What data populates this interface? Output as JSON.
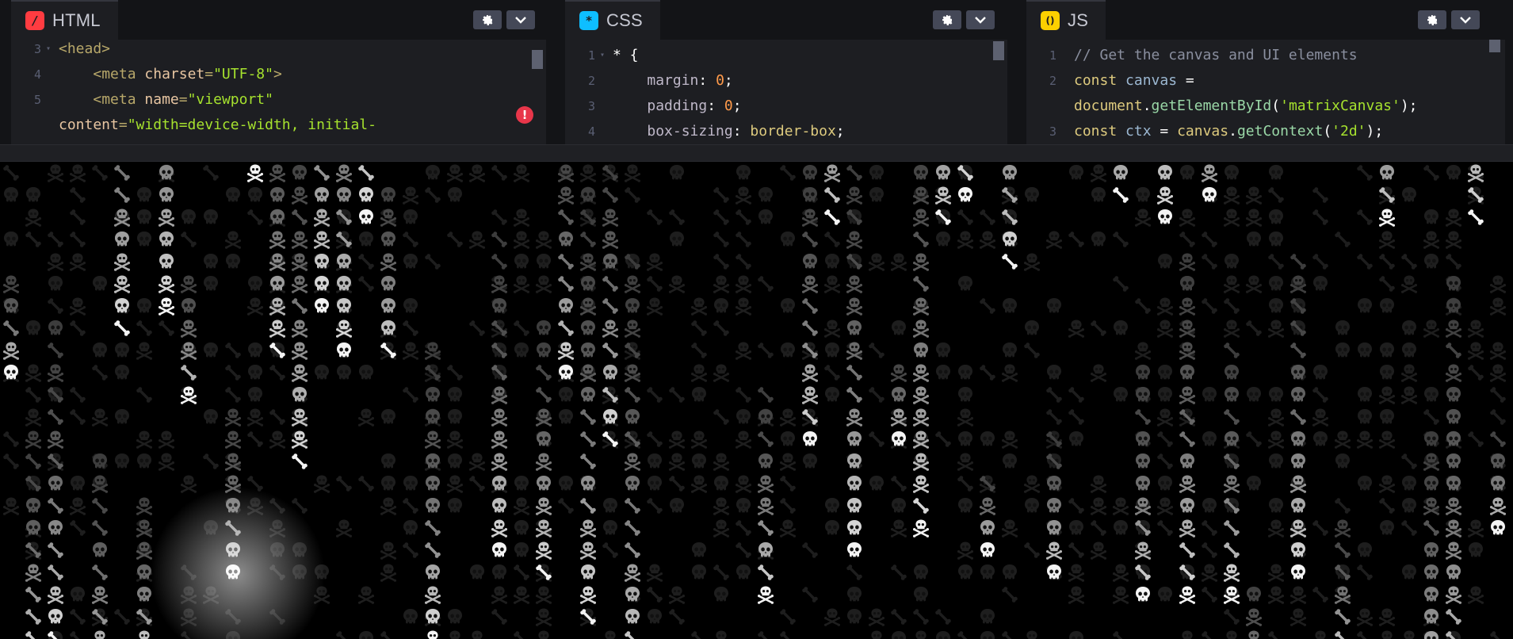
{
  "editors": {
    "html": {
      "label": "HTML",
      "icon_glyph": "/",
      "icon_color": "#ff3c41",
      "lines": [
        {
          "n": "3",
          "fold": true,
          "parts": [
            [
              "tag",
              "<head>"
            ]
          ],
          "indent": ""
        },
        {
          "n": "4",
          "fold": false,
          "indent": "    ",
          "parts": [
            [
              "tag",
              "<meta "
            ],
            [
              "attr",
              "charset"
            ],
            [
              "tag",
              "="
            ],
            [
              "str",
              "\"UTF-8\""
            ],
            [
              "tag",
              ">"
            ]
          ]
        },
        {
          "n": "5",
          "fold": false,
          "indent": "    ",
          "parts": [
            [
              "tag",
              "<meta "
            ],
            [
              "attr",
              "name"
            ],
            [
              "tag",
              "="
            ],
            [
              "str",
              "\"viewport\""
            ]
          ]
        },
        {
          "n": "",
          "fold": false,
          "indent": "",
          "parts": [
            [
              "attr",
              "content"
            ],
            [
              "tag",
              "="
            ],
            [
              "str",
              "\"width=device-width, initial-"
            ]
          ]
        }
      ]
    },
    "css": {
      "label": "CSS",
      "icon_glyph": "*",
      "icon_color": "#0ebeff",
      "lines": [
        {
          "n": "1",
          "fold": true,
          "indent": "",
          "parts": [
            [
              "sel",
              "* {"
            ]
          ]
        },
        {
          "n": "2",
          "fold": false,
          "indent": "    ",
          "parts": [
            [
              "prop",
              "margin"
            ],
            [
              "sel",
              ": "
            ],
            [
              "num",
              "0"
            ],
            [
              "sel",
              ";"
            ]
          ]
        },
        {
          "n": "3",
          "fold": false,
          "indent": "    ",
          "parts": [
            [
              "prop",
              "padding"
            ],
            [
              "sel",
              ": "
            ],
            [
              "num",
              "0"
            ],
            [
              "sel",
              ";"
            ]
          ]
        },
        {
          "n": "4",
          "fold": false,
          "indent": "    ",
          "parts": [
            [
              "prop",
              "box-sizing"
            ],
            [
              "sel",
              ": "
            ],
            [
              "kw",
              "border-box"
            ],
            [
              "sel",
              ";"
            ]
          ]
        }
      ]
    },
    "js": {
      "label": "JS",
      "icon_glyph": "()",
      "icon_color": "#fcd000",
      "lines": [
        {
          "n": "1",
          "fold": false,
          "indent": "",
          "parts": [
            [
              "cmt",
              "// Get the canvas and UI elements"
            ]
          ]
        },
        {
          "n": "2",
          "fold": false,
          "indent": "",
          "parts": [
            [
              "kw",
              "const "
            ],
            [
              "var",
              "canvas"
            ],
            [
              "sel",
              " ="
            ]
          ]
        },
        {
          "n": "",
          "fold": false,
          "indent": "",
          "parts": [
            [
              "kw",
              "document"
            ],
            [
              "sel",
              "."
            ],
            [
              "fn",
              "getElementById"
            ],
            [
              "sel",
              "("
            ],
            [
              "str",
              "'matrixCanvas'"
            ],
            [
              "sel",
              ");"
            ]
          ]
        },
        {
          "n": "3",
          "fold": false,
          "indent": "",
          "parts": [
            [
              "kw",
              "const "
            ],
            [
              "var",
              "ctx"
            ],
            [
              "sel",
              " = "
            ],
            [
              "kw",
              "canvas"
            ],
            [
              "sel",
              "."
            ],
            [
              "fn",
              "getContext"
            ],
            [
              "sel",
              "("
            ],
            [
              "str",
              "'2d'"
            ],
            [
              "sel",
              ");"
            ]
          ]
        }
      ]
    }
  },
  "preview": {
    "glyphs": [
      "skull",
      "skull-crossbones",
      "bone"
    ],
    "background": "#000000"
  }
}
